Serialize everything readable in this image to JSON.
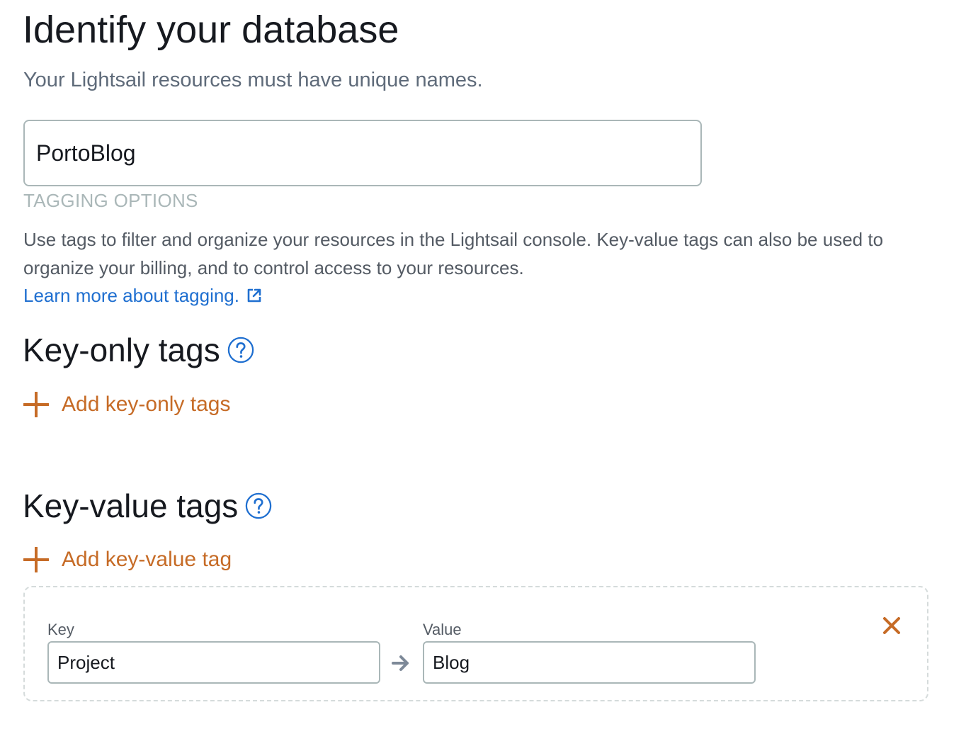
{
  "header": {
    "title": "Identify your database",
    "subtitle": "Your Lightsail resources must have unique names."
  },
  "name_input": {
    "value": "PortoBlog"
  },
  "tagging": {
    "section_label": "TAGGING OPTIONS",
    "description": "Use tags to filter and organize your resources in the Lightsail console. Key-value tags can also be used to organize your billing, and to control access to your resources.",
    "learn_more_label": "Learn more about tagging."
  },
  "key_only": {
    "title": "Key-only tags",
    "add_label": "Add key-only tags"
  },
  "key_value": {
    "title": "Key-value tags",
    "add_label": "Add key-value tag",
    "rows": [
      {
        "key_label": "Key",
        "key_value": "Project",
        "value_label": "Value",
        "value_value": "Blog"
      }
    ]
  },
  "icons": {
    "help": "help-icon",
    "external": "external-link-icon",
    "plus": "plus-icon",
    "arrow": "arrow-right-icon",
    "remove": "close-icon"
  },
  "colors": {
    "link_blue": "#1f6fd0",
    "accent_orange": "#c66b26",
    "text_dark": "#16191f",
    "text_muted": "#5f6b7a",
    "border": "#aab7b8"
  }
}
